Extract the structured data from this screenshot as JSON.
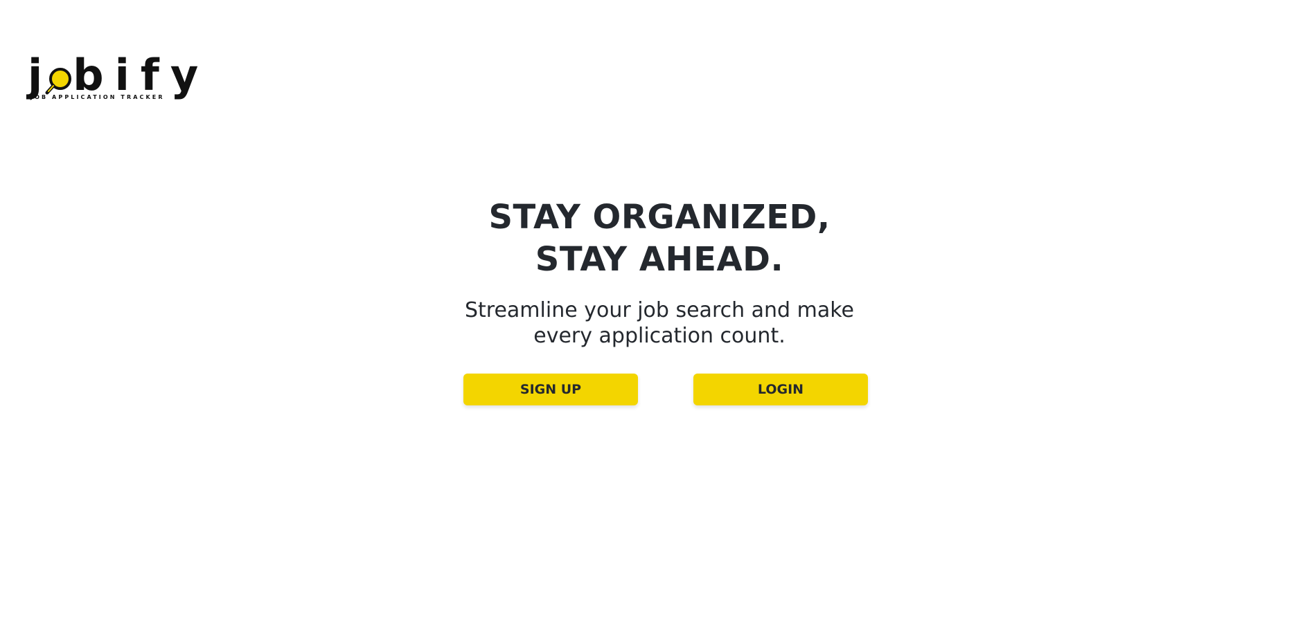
{
  "logo": {
    "letters": [
      "j",
      "b",
      "i",
      "f",
      "y"
    ],
    "tagline": "JOB APPLICATION TRACKER",
    "accent_color": "#f3d500",
    "icon": "magnifier-icon"
  },
  "hero": {
    "title_line1": "STAY ORGANIZED,",
    "title_line2": "STAY AHEAD.",
    "subtitle_line1": "Streamline your job search and make",
    "subtitle_line2": "every application count."
  },
  "actions": {
    "signup_label": "SIGN UP",
    "login_label": "LOGIN",
    "button_color": "#f3d500"
  }
}
